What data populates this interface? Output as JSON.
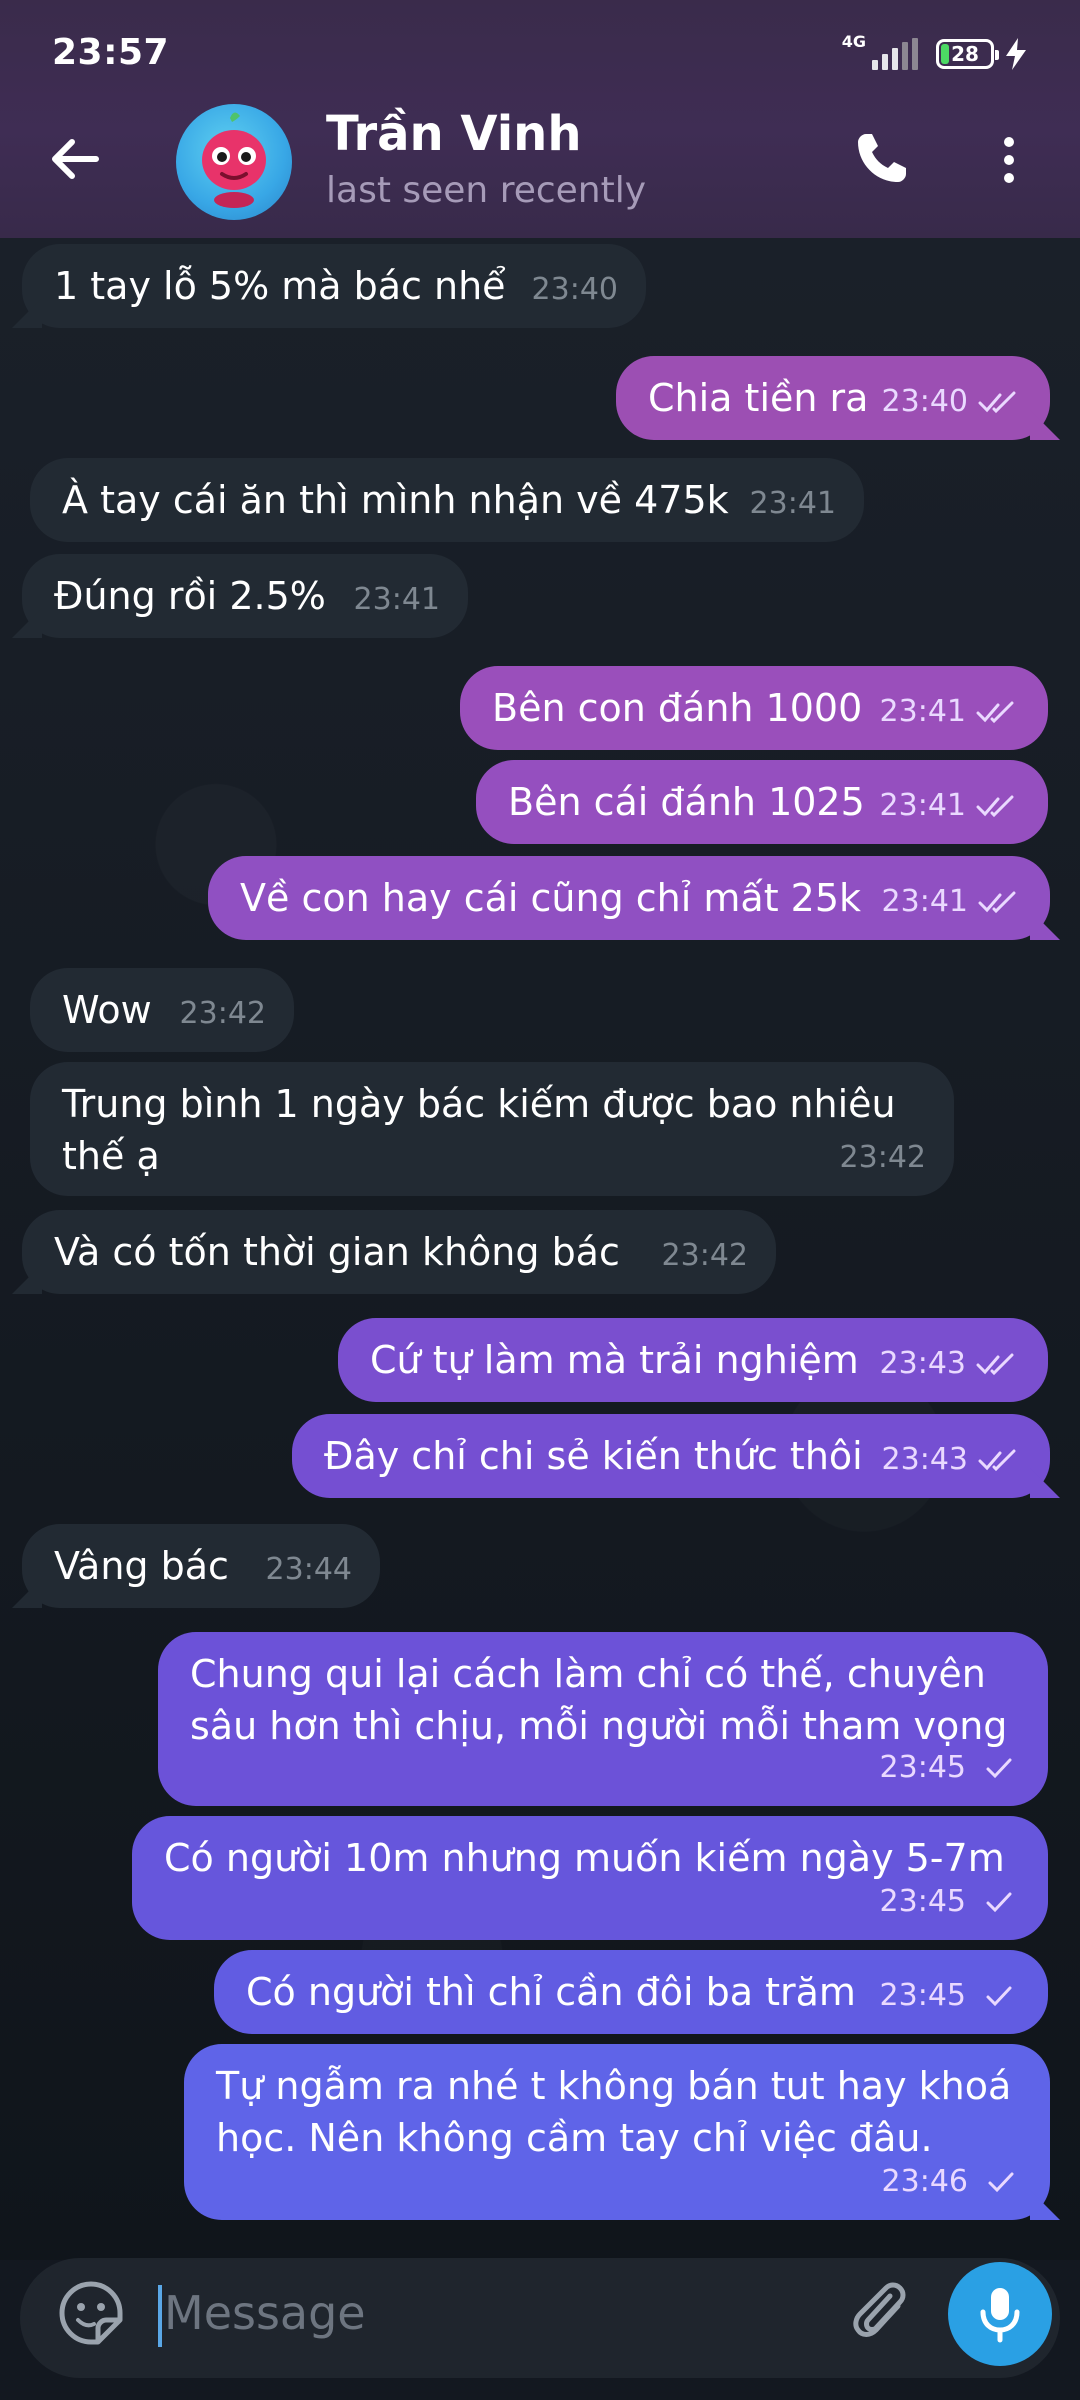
{
  "status_bar": {
    "time": "23:57",
    "network": "4G",
    "battery": "28"
  },
  "header": {
    "name": "Trần Vinh",
    "status": "last seen recently"
  },
  "messages": [
    {
      "dir": "in",
      "text": "1 tay lỗ 5% mà bác nhể",
      "time": "23:40"
    },
    {
      "dir": "out",
      "text": "Chia tiền ra",
      "time": "23:40",
      "read": true,
      "color": "#9c4fb3"
    },
    {
      "dir": "in",
      "text": "À tay cái ăn thì mình nhận về 475k",
      "time": "23:41"
    },
    {
      "dir": "in",
      "text": "Đúng rồi 2.5%",
      "time": "23:41"
    },
    {
      "dir": "out",
      "text": "Bên con đánh 1000",
      "time": "23:41",
      "read": true,
      "color": "#9a4fbb"
    },
    {
      "dir": "out",
      "text": "Bên cái đánh 1025",
      "time": "23:41",
      "read": true,
      "color": "#954fbf"
    },
    {
      "dir": "out",
      "text": "Về con hay cái cũng chỉ mất 25k",
      "time": "23:41",
      "read": true,
      "color": "#9050c2"
    },
    {
      "dir": "in",
      "text": "Wow",
      "time": "23:42"
    },
    {
      "dir": "in",
      "text": "Trung bình 1 ngày bác kiếm được bao nhiêu\nthế ạ",
      "time": "23:42"
    },
    {
      "dir": "in",
      "text": "Và có tốn thời gian không bác",
      "time": "23:42"
    },
    {
      "dir": "out",
      "text": "Cứ tự làm mà trải nghiệm",
      "time": "23:43",
      "read": true,
      "color": "#7a4fcf"
    },
    {
      "dir": "out",
      "text": "Đây chỉ chi sẻ kiến thức thôi",
      "time": "23:43",
      "read": true,
      "color": "#754fd2"
    },
    {
      "dir": "in",
      "text": "Vâng bác",
      "time": "23:44"
    },
    {
      "dir": "out",
      "text": "Chung qui lại cách làm chỉ có thế, chuyên\nsâu hơn thì chịu, mỗi người mỗi tham vọng",
      "time": "23:45",
      "read": false,
      "color": "#6c52d8"
    },
    {
      "dir": "out",
      "text": "Có người 10m nhưng muốn kiếm ngày 5-7m",
      "time": "23:45",
      "read": false,
      "color": "#6656dc"
    },
    {
      "dir": "out",
      "text": "Có người thì chỉ cần đôi ba trăm",
      "time": "23:45",
      "read": false,
      "color": "#615ce2"
    },
    {
      "dir": "out",
      "text": "Tự ngẫm ra nhé t không bán tut hay khoá\nhọc. Nên không cầm tay chỉ việc đâu.",
      "time": "23:46",
      "read": false,
      "color": "#5f64e8"
    }
  ],
  "input": {
    "placeholder": "Message"
  },
  "icons": {
    "back": "back-arrow-icon",
    "call": "phone-icon",
    "menu": "more-vertical-icon",
    "emoji": "sticker-emoji-icon",
    "attach": "paperclip-icon",
    "mic": "microphone-icon",
    "read": "double-check-icon",
    "sent": "single-check-icon"
  }
}
